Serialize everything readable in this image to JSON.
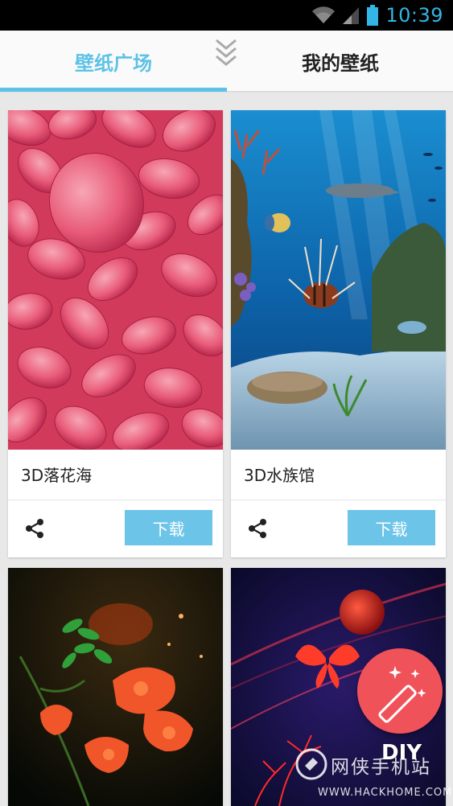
{
  "status_bar": {
    "time": "10:39",
    "icons": [
      "wifi-icon",
      "signal-icon",
      "battery-icon"
    ],
    "color": "#33b5e5"
  },
  "tabs": [
    {
      "label": "壁纸广场",
      "active": true
    },
    {
      "label": "我的壁纸",
      "active": false
    }
  ],
  "accent_color": "#5cc2e6",
  "wallpapers": [
    {
      "title": "3D落花海",
      "download_label": "下载",
      "share_icon": "share-icon"
    },
    {
      "title": "3D水族馆",
      "download_label": "下载",
      "share_icon": "share-icon"
    },
    {
      "title": "",
      "download_label": "",
      "share_icon": ""
    },
    {
      "title": "",
      "download_label": "",
      "share_icon": ""
    }
  ],
  "fab": {
    "label": "DIY",
    "icon": "magic-wand-icon",
    "color": "#f0525a"
  },
  "watermark": {
    "text": "网侠手机站",
    "sub": "WWW.HACKHOME.COM"
  }
}
